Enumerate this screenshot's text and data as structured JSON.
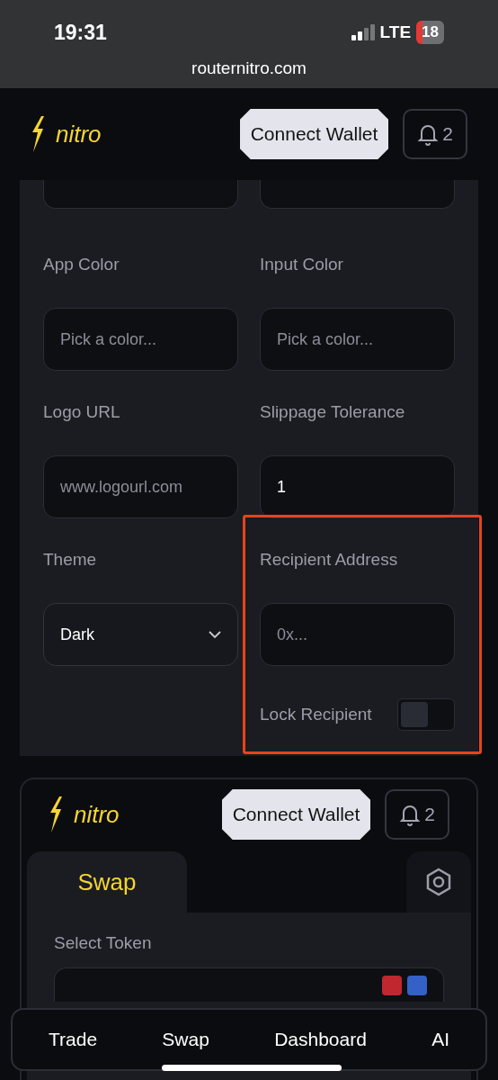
{
  "status_bar": {
    "time": "19:31",
    "network": "LTE",
    "battery": "18"
  },
  "browser": {
    "url": "routernitro.com"
  },
  "header": {
    "logo": "nitro",
    "connect_button": "Connect Wallet",
    "notifications": "2"
  },
  "settings_form": {
    "fields": [
      {
        "kind": "input",
        "label": "App Color",
        "placeholder": "Pick a color..."
      },
      {
        "kind": "input",
        "label": "Input Color",
        "placeholder": "Pick a color..."
      },
      {
        "kind": "input",
        "label": "Logo URL",
        "placeholder": "www.logourl.com"
      },
      {
        "kind": "input",
        "label": "Slippage Tolerance",
        "value": "1"
      },
      {
        "kind": "select",
        "label": "Theme",
        "value": "Dark"
      },
      {
        "kind": "input",
        "label": "Recipient Address",
        "placeholder": "0x..."
      }
    ],
    "lock_recipient": {
      "label": "Lock Recipient",
      "on": false
    }
  },
  "widget": {
    "header": {
      "logo": "nitro",
      "connect_button": "Connect Wallet",
      "notifications": "2"
    },
    "tabs": [
      {
        "label": "Swap",
        "selected": true
      }
    ],
    "select_token_label": "Select Token"
  },
  "bottom_nav": [
    {
      "label": "Trade"
    },
    {
      "label": "Swap"
    },
    {
      "label": "Dashboard"
    },
    {
      "label": "AI"
    }
  ]
}
